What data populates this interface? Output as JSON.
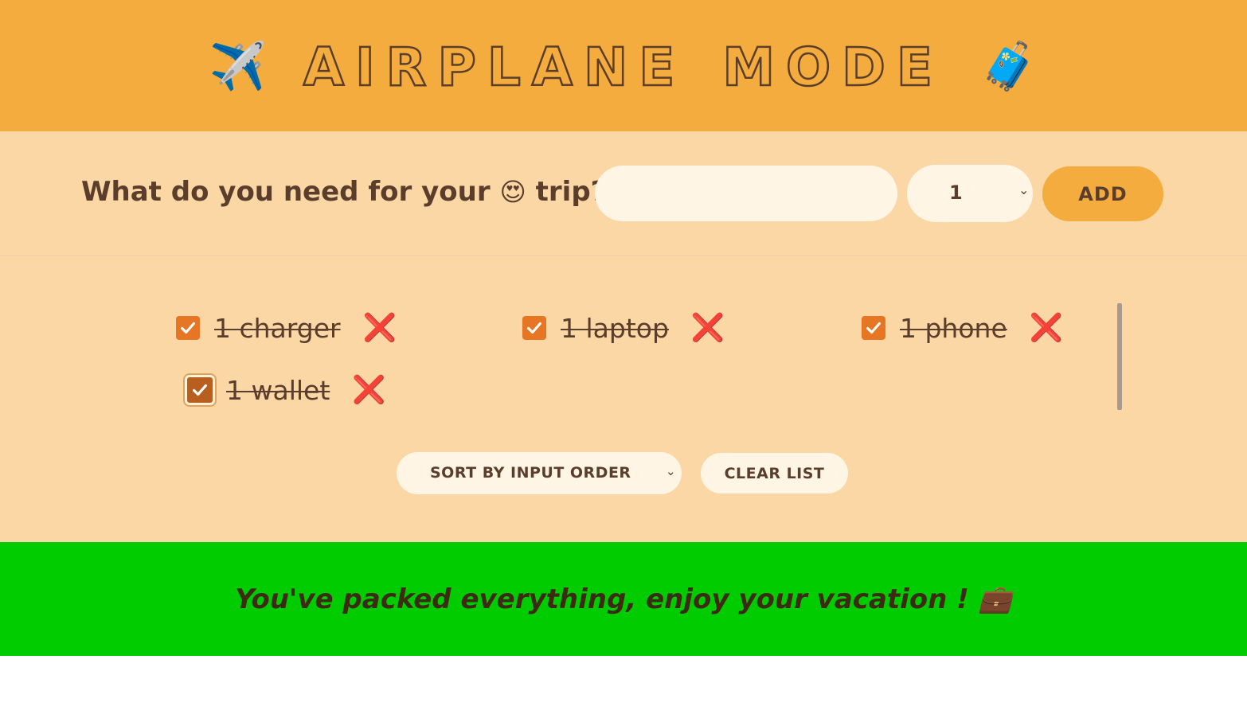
{
  "header": {
    "left_emoji": "✈️",
    "title_words": [
      "AIRPLANE",
      "MODE"
    ],
    "right_emoji": "🧳"
  },
  "form": {
    "question_prefix": "What do you need for your",
    "question_emoji": "😍",
    "question_suffix": "trip?",
    "item_input_value": "",
    "quantity_selected": "1",
    "add_label": "ADD"
  },
  "items": [
    {
      "label": "1 charger",
      "checked": true
    },
    {
      "label": "1 laptop",
      "checked": true
    },
    {
      "label": "1 phone",
      "checked": true
    },
    {
      "label": "1 wallet",
      "checked": true
    }
  ],
  "actions": {
    "sort_selected": "SORT BY INPUT ORDER",
    "clear_label": "CLEAR LIST"
  },
  "footer": {
    "message": "You've packed everything, enjoy your vacation ! 💼"
  },
  "colors": {
    "header_bg": "#f4ac3e",
    "body_bg": "#fad7a5",
    "footer_bg": "#00cc00",
    "text": "#5a3e2b",
    "checkbox": "#e67524",
    "delete": "#e5131a"
  }
}
